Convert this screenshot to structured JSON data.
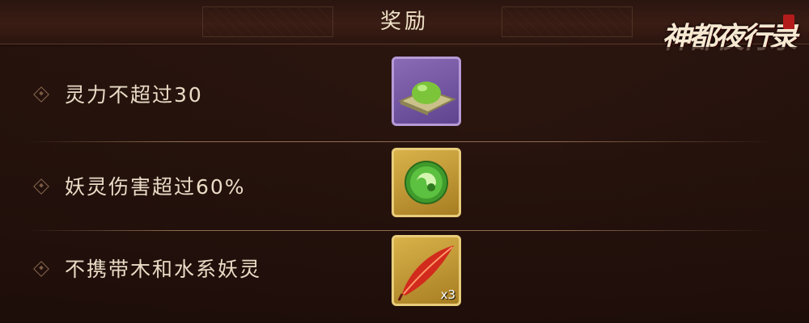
{
  "header": {
    "title": "奖励"
  },
  "logo": {
    "text": "神都夜行录"
  },
  "rewards": [
    {
      "condition": "灵力不超过30",
      "item_icon": "green-dumpling-icon",
      "frame": "purple",
      "quantity": ""
    },
    {
      "condition": "妖灵伤害超过60%",
      "item_icon": "jade-orb-icon",
      "frame": "gold",
      "quantity": ""
    },
    {
      "condition": "不携带木和水系妖灵",
      "item_icon": "red-feather-icon",
      "frame": "gold",
      "quantity": "x3"
    }
  ],
  "colors": {
    "text": "#e9dcc6",
    "title": "#f0e2c8",
    "purple_frame": "#7a5aa8",
    "gold_frame": "#c9a040"
  }
}
